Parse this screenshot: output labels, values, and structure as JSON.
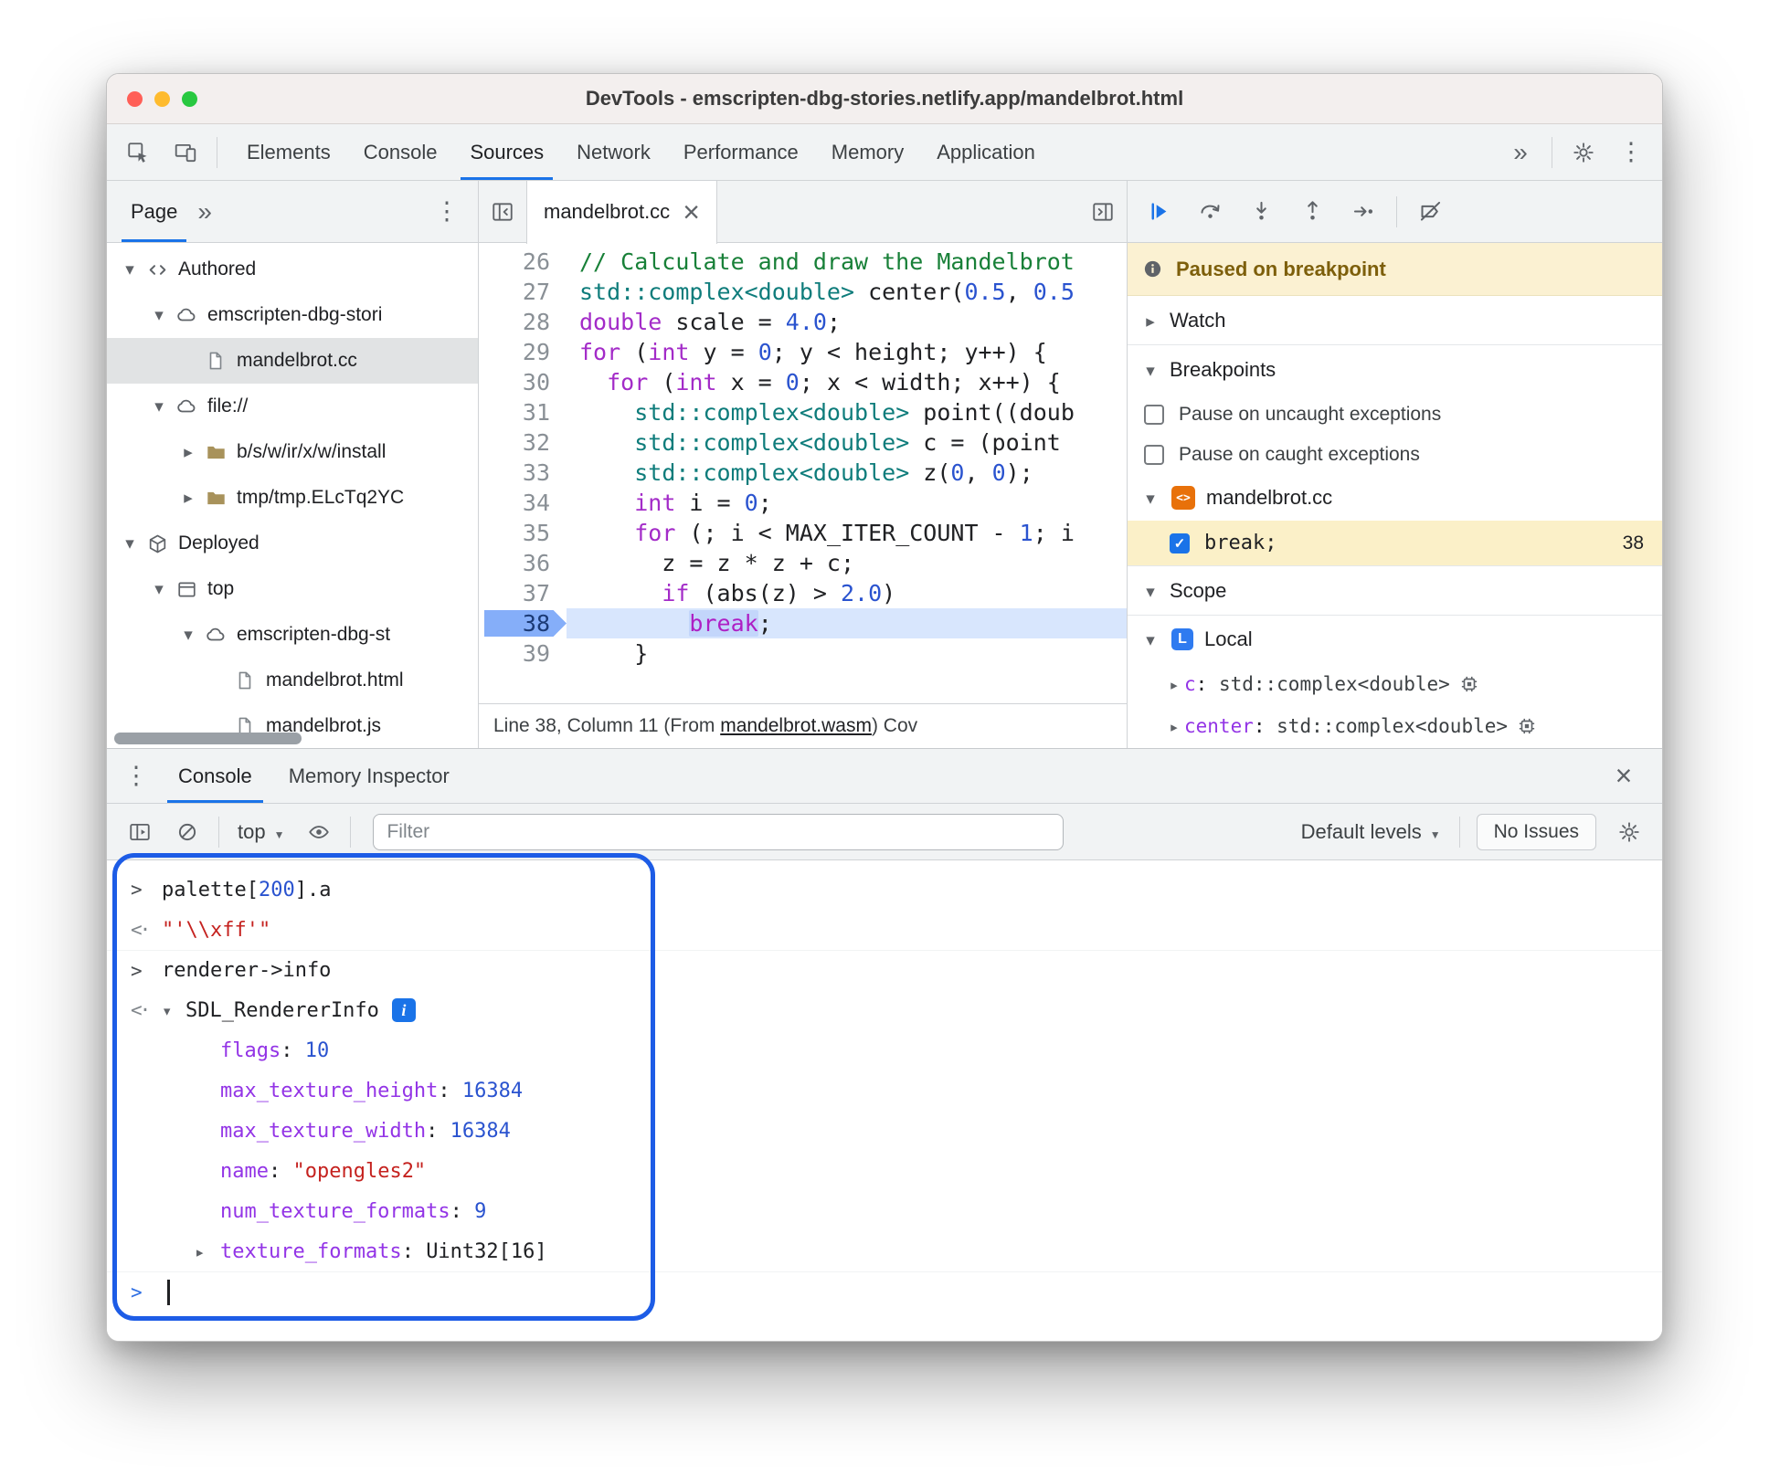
{
  "window": {
    "title": "DevTools - emscripten-dbg-stories.netlify.app/mandelbrot.html"
  },
  "colors": {
    "accent": "#1a73e8",
    "annotation_blue": "#1d5ce6",
    "paused_banner_bg": "#fbf1d2",
    "breakpoint_row_bg": "#fbf0c8",
    "string_red": "#c5221f",
    "number_blue": "#2a53cf",
    "property_purple": "#9334e6"
  },
  "chrome_tabs": {
    "items": [
      "Elements",
      "Console",
      "Sources",
      "Network",
      "Performance",
      "Memory",
      "Application"
    ],
    "active": "Sources"
  },
  "navigator": {
    "tab": "Page",
    "tree": [
      {
        "label": "Authored",
        "level": 0,
        "exp": "open",
        "icon": "code"
      },
      {
        "label": "emscripten-dbg-stori",
        "level": 1,
        "exp": "open",
        "icon": "cloud"
      },
      {
        "label": "mandelbrot.cc",
        "level": 2,
        "icon": "file",
        "selected": true
      },
      {
        "label": "file://",
        "level": 1,
        "exp": "open",
        "icon": "cloud"
      },
      {
        "label": "b/s/w/ir/x/w/install",
        "level": 2,
        "exp": "closed",
        "icon": "folder"
      },
      {
        "label": "tmp/tmp.ELcTq2YC",
        "level": 2,
        "exp": "closed",
        "icon": "folder"
      },
      {
        "label": "Deployed",
        "level": 0,
        "exp": "open",
        "icon": "cube"
      },
      {
        "label": "top",
        "level": 1,
        "exp": "open",
        "icon": "frame"
      },
      {
        "label": "emscripten-dbg-st",
        "level": 2,
        "exp": "open",
        "icon": "cloud"
      },
      {
        "label": "mandelbrot.html",
        "level": 3,
        "icon": "file"
      },
      {
        "label": "mandelbrot.js",
        "level": 3,
        "icon": "file"
      }
    ]
  },
  "editor": {
    "tab": "mandelbrot.cc",
    "lines": [
      {
        "n": 26,
        "t": [
          [
            "cm",
            "// Calculate and draw the Mandelbrot"
          ]
        ]
      },
      {
        "n": 27,
        "t": [
          [
            "ty",
            "std::complex<double>"
          ],
          [
            "pl",
            " center("
          ],
          [
            "nu",
            "0.5"
          ],
          [
            "pl",
            ", "
          ],
          [
            "nu",
            "0.5"
          ]
        ]
      },
      {
        "n": 28,
        "t": [
          [
            "kw",
            "double"
          ],
          [
            "pl",
            " scale = "
          ],
          [
            "nu",
            "4.0"
          ],
          [
            "pl",
            ";"
          ]
        ]
      },
      {
        "n": 29,
        "t": [
          [
            "kw",
            "for"
          ],
          [
            "pl",
            " ("
          ],
          [
            "kw",
            "int"
          ],
          [
            "pl",
            " y = "
          ],
          [
            "nu",
            "0"
          ],
          [
            "pl",
            "; y < height; y++) {"
          ]
        ]
      },
      {
        "n": 30,
        "t": [
          [
            "pl",
            "  "
          ],
          [
            "kw",
            "for"
          ],
          [
            "pl",
            " ("
          ],
          [
            "kw",
            "int"
          ],
          [
            "pl",
            " x = "
          ],
          [
            "nu",
            "0"
          ],
          [
            "pl",
            "; x < width; x++) {"
          ]
        ]
      },
      {
        "n": 31,
        "t": [
          [
            "pl",
            "    "
          ],
          [
            "ty",
            "std::complex<double>"
          ],
          [
            "pl",
            " point((doub"
          ]
        ]
      },
      {
        "n": 32,
        "t": [
          [
            "pl",
            "    "
          ],
          [
            "ty",
            "std::complex<double>"
          ],
          [
            "pl",
            " c = (point"
          ]
        ]
      },
      {
        "n": 33,
        "t": [
          [
            "pl",
            "    "
          ],
          [
            "ty",
            "std::complex<double>"
          ],
          [
            "pl",
            " z("
          ],
          [
            "nu",
            "0"
          ],
          [
            "pl",
            ", "
          ],
          [
            "nu",
            "0"
          ],
          [
            "pl",
            ");"
          ]
        ]
      },
      {
        "n": 34,
        "t": [
          [
            "pl",
            "    "
          ],
          [
            "kw",
            "int"
          ],
          [
            "pl",
            " i = "
          ],
          [
            "nu",
            "0"
          ],
          [
            "pl",
            ";"
          ]
        ]
      },
      {
        "n": 35,
        "t": [
          [
            "pl",
            "    "
          ],
          [
            "kw",
            "for"
          ],
          [
            "pl",
            " (; i < MAX_ITER_COUNT - "
          ],
          [
            "nu",
            "1"
          ],
          [
            "pl",
            "; i"
          ]
        ]
      },
      {
        "n": 36,
        "t": [
          [
            "pl",
            "      z = z * z + c;"
          ]
        ]
      },
      {
        "n": 37,
        "t": [
          [
            "pl",
            "      "
          ],
          [
            "kw",
            "if"
          ],
          [
            "pl",
            " (abs(z) > "
          ],
          [
            "nu",
            "2.0"
          ],
          [
            "pl",
            ")"
          ]
        ]
      },
      {
        "n": 38,
        "cur": true,
        "t": [
          [
            "pl",
            "        "
          ],
          [
            "kwsel",
            "break"
          ],
          [
            "pl",
            ";"
          ]
        ]
      },
      {
        "n": 39,
        "t": [
          [
            "pl",
            "    }"
          ]
        ]
      }
    ],
    "status": {
      "position": "Line 38, Column 11",
      "source_prefix": " (From ",
      "source_link": "mandelbrot.wasm",
      "source_suffix": ") ",
      "tail": "Cov"
    }
  },
  "debugger": {
    "toolbar_icons": [
      "resume",
      "step-over",
      "step-into",
      "step-out",
      "step",
      "deactivate-breakpoints"
    ],
    "banner": "Paused on breakpoint",
    "watch_label": "Watch",
    "breakpoints_label": "Breakpoints",
    "pause_uncaught": "Pause on uncaught exceptions",
    "pause_caught": "Pause on caught exceptions",
    "breakpoints_file": "mandelbrot.cc",
    "breakpoint_code": "break;",
    "breakpoint_line": "38",
    "scope_label": "Scope",
    "local_label": "Local",
    "vars": [
      {
        "name": "c",
        "value": "std::complex<double>"
      },
      {
        "name": "center",
        "value": "std::complex<double>"
      }
    ]
  },
  "drawer": {
    "tabs": [
      {
        "label": "Console",
        "active": true
      },
      {
        "label": "Memory Inspector",
        "active": false
      }
    ],
    "toolbar": {
      "context": "top",
      "filter_placeholder": "Filter",
      "levels": "Default levels",
      "issues": "No Issues"
    },
    "console": {
      "entries": [
        {
          "kind": "input",
          "tokens": [
            [
              "pl",
              "palette["
            ],
            [
              "nu",
              "200"
            ],
            [
              "pl",
              "].a"
            ]
          ]
        },
        {
          "kind": "result",
          "tokens": [
            [
              "str",
              "\"'\\\\xff'\""
            ]
          ]
        },
        {
          "kind": "input",
          "tokens": [
            [
              "pl",
              "renderer->info"
            ]
          ]
        },
        {
          "kind": "object",
          "name": "SDL_RendererInfo",
          "badge": "i",
          "props": [
            {
              "key": "flags",
              "val": "10",
              "cls": "nu"
            },
            {
              "key": "max_texture_height",
              "val": "16384",
              "cls": "nu"
            },
            {
              "key": "max_texture_width",
              "val": "16384",
              "cls": "nu"
            },
            {
              "key": "name",
              "val": "\"opengles2\"",
              "cls": "str"
            },
            {
              "key": "num_texture_formats",
              "val": "9",
              "cls": "nu"
            },
            {
              "key": "texture_formats",
              "val": "Uint32[16]",
              "cls": "pl",
              "tri": true
            }
          ]
        },
        {
          "kind": "prompt"
        }
      ]
    }
  }
}
